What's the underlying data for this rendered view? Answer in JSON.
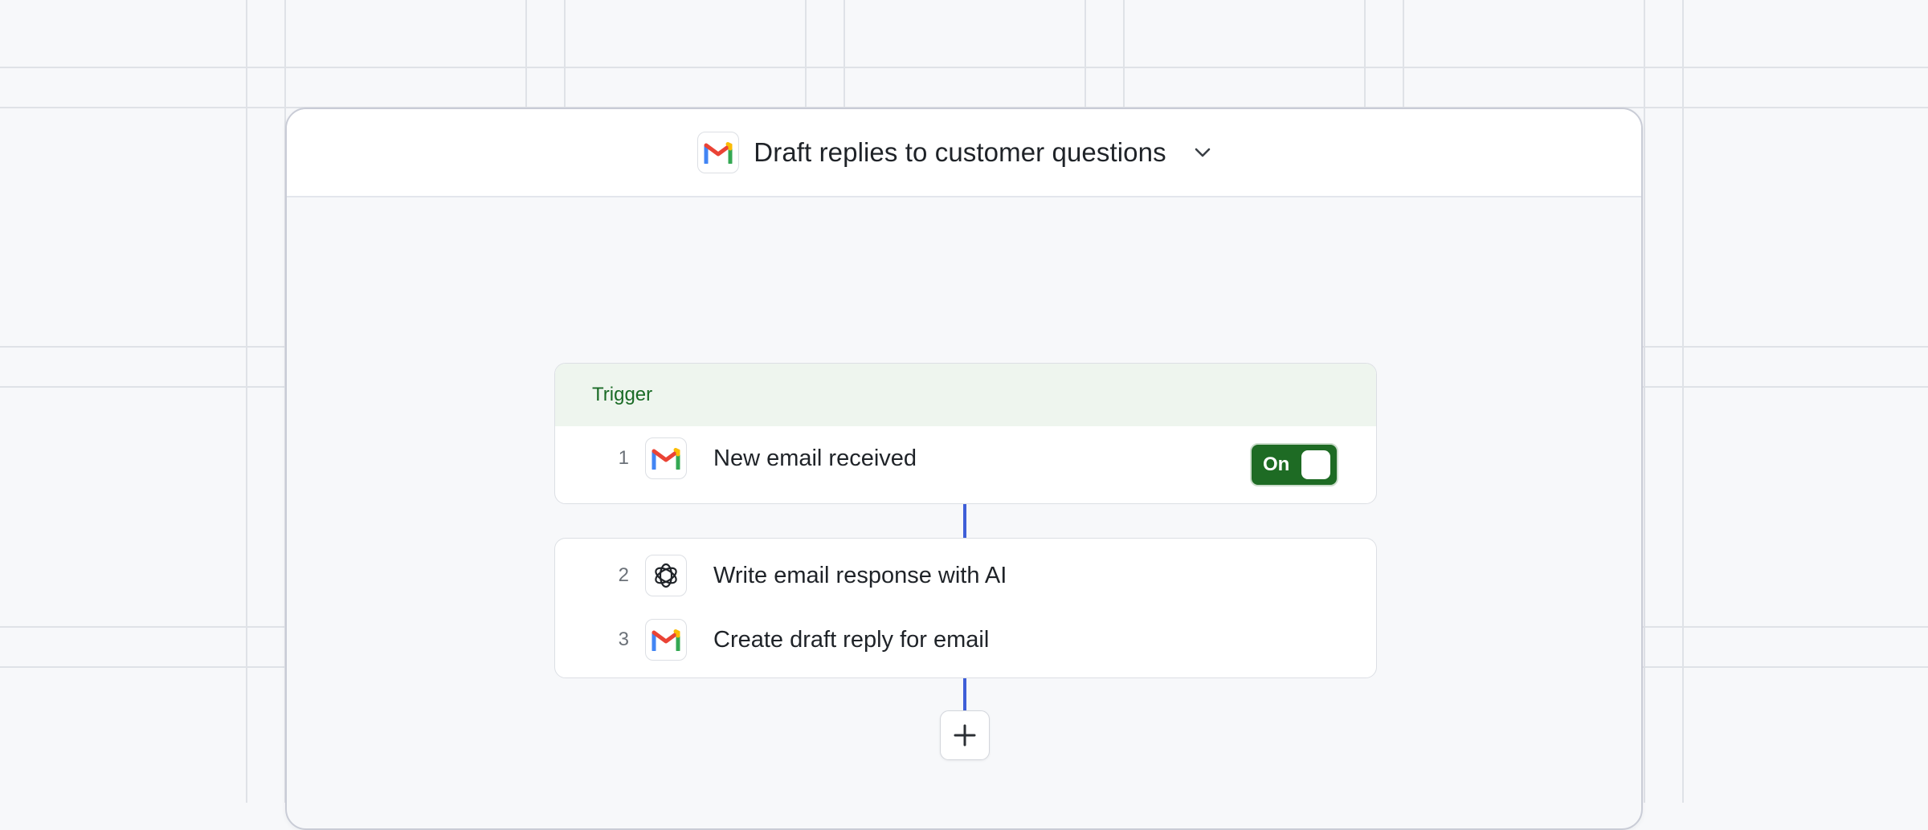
{
  "workflow": {
    "title": "Draft replies to customer questions",
    "app_icon": "gmail-icon"
  },
  "trigger": {
    "section_label": "Trigger",
    "step": {
      "number": "1",
      "label": "New email received",
      "icon": "gmail-icon"
    },
    "toggle": {
      "label": "On",
      "state": "on",
      "color": "#1e6b24"
    }
  },
  "steps": [
    {
      "number": "2",
      "label": "Write email response with AI",
      "icon": "openai-icon"
    },
    {
      "number": "3",
      "label": "Create draft reply for email",
      "icon": "gmail-icon"
    }
  ],
  "add_step": {
    "icon": "plus-icon"
  },
  "colors": {
    "connector": "#3f5fd8",
    "trigger_header_bg": "#eef5ee",
    "trigger_text": "#1a6b26",
    "background": "#f7f8fa"
  }
}
